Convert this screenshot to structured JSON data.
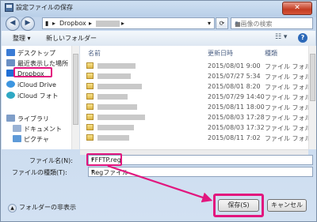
{
  "window": {
    "title": "設定ファイルの保存",
    "close_label": "✕"
  },
  "nav": {
    "back": "◀",
    "forward": "▶",
    "breadcrumb": [
      "Dropbox"
    ],
    "search_placeholder": "■画像の検索"
  },
  "toolbar": {
    "organize": "整理 ▾",
    "new_folder": "新しいフォルダー",
    "help": "?"
  },
  "sidebar": {
    "items": [
      {
        "label": "デスクトップ",
        "color": "#3a7bd5"
      },
      {
        "label": "最近表示した場所",
        "color": "#6a8fc4"
      },
      {
        "label": "Dropbox",
        "color": "#1f6fd6"
      },
      {
        "label": "iCloud Drive",
        "color": "#3c95e0"
      },
      {
        "label": "iCloud フォト",
        "color": "#2fa8c4"
      },
      {
        "label": "ライブラリ",
        "color": "#7f9ec8"
      },
      {
        "label": "ドキュメント",
        "color": "#9ab2d4"
      },
      {
        "label": "ピクチャ",
        "color": "#5e9ad8"
      }
    ]
  },
  "filelist": {
    "columns": {
      "name": "名前",
      "date": "更新日時",
      "type": "種類"
    },
    "rows": [
      {
        "date": "2015/08/01 9:00",
        "type": "ファイル フォル"
      },
      {
        "date": "2015/07/27 5:34",
        "type": "ファイル フォル"
      },
      {
        "date": "2015/08/01 8:20",
        "type": "ファイル フォル"
      },
      {
        "date": "2015/07/29 14:40",
        "type": "ファイル フォル"
      },
      {
        "date": "2015/08/11 18:00",
        "type": "ファイル フォル"
      },
      {
        "date": "2015/08/03 17:28",
        "type": "ファイル フォル"
      },
      {
        "date": "2015/08/03 17:32",
        "type": "ファイル フォル"
      },
      {
        "date": "2015/08/11 7:02",
        "type": "ファイル フォル"
      }
    ]
  },
  "form": {
    "filename_label": "ファイル名(N):",
    "filename_value": "FFFTP.reg",
    "filetype_label": "ファイルの種類(T):",
    "filetype_value": "Regファイル"
  },
  "footer": {
    "hide_folders": "フォルダーの非表示",
    "save": "保存(S)",
    "cancel": "キャンセル"
  },
  "colors": {
    "annotation": "#e2167e"
  }
}
